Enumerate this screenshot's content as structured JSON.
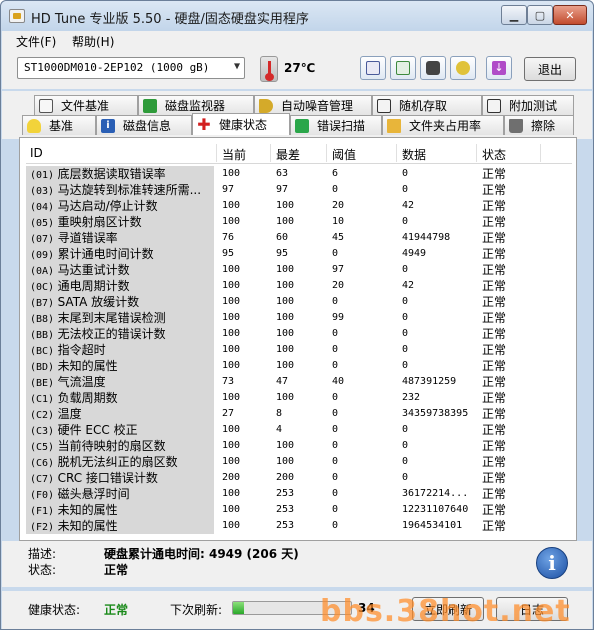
{
  "window": {
    "title": "HD Tune 专业版 5.50 - 硬盘/固态硬盘实用程序"
  },
  "menu": [
    {
      "label": "文件(F)"
    },
    {
      "label": "帮助(H)"
    }
  ],
  "toolbar": {
    "drive": "ST1000DM010-2EP102 (1000 gB)",
    "temperature": "27℃",
    "exit_label": "退出"
  },
  "tabs_row1": [
    {
      "label": "文件基准",
      "icon": "document-benchmark-icon"
    },
    {
      "label": "磁盘监视器",
      "icon": "disk-monitor-icon"
    },
    {
      "label": "自动噪音管理",
      "icon": "speaker-icon"
    },
    {
      "label": "随机存取",
      "icon": "random-access-icon"
    },
    {
      "label": "附加测试",
      "icon": "extra-tests-icon"
    }
  ],
  "tabs_row2": [
    {
      "label": "基准",
      "icon": "lightbulb-icon"
    },
    {
      "label": "磁盘信息",
      "icon": "info-icon"
    },
    {
      "label": "健康状态",
      "icon": "red-cross-icon",
      "active": true
    },
    {
      "label": "错误扫描",
      "icon": "error-scan-icon"
    },
    {
      "label": "文件夹占用率",
      "icon": "folder-icon"
    },
    {
      "label": "擦除",
      "icon": "trash-icon"
    }
  ],
  "table": {
    "headers": {
      "id": "ID",
      "current": "当前",
      "worst": "最差",
      "threshold": "阈值",
      "data": "数据",
      "status": "状态"
    },
    "rows": [
      {
        "code": "(01)",
        "name": "底层数据读取错误率",
        "current": "100",
        "worst": "63",
        "threshold": "6",
        "data": "0",
        "status": "正常"
      },
      {
        "code": "(03)",
        "name": "马达旋转到标准转速所需...",
        "current": "97",
        "worst": "97",
        "threshold": "0",
        "data": "0",
        "status": "正常"
      },
      {
        "code": "(04)",
        "name": "马达启动/停止计数",
        "current": "100",
        "worst": "100",
        "threshold": "20",
        "data": "42",
        "status": "正常"
      },
      {
        "code": "(05)",
        "name": "重映射扇区计数",
        "current": "100",
        "worst": "100",
        "threshold": "10",
        "data": "0",
        "status": "正常"
      },
      {
        "code": "(07)",
        "name": "寻道错误率",
        "current": "76",
        "worst": "60",
        "threshold": "45",
        "data": "41944798",
        "status": "正常"
      },
      {
        "code": "(09)",
        "name": "累计通电时间计数",
        "current": "95",
        "worst": "95",
        "threshold": "0",
        "data": "4949",
        "status": "正常"
      },
      {
        "code": "(0A)",
        "name": "马达重试计数",
        "current": "100",
        "worst": "100",
        "threshold": "97",
        "data": "0",
        "status": "正常"
      },
      {
        "code": "(0C)",
        "name": "通电周期计数",
        "current": "100",
        "worst": "100",
        "threshold": "20",
        "data": "42",
        "status": "正常"
      },
      {
        "code": "(B7)",
        "name": "SATA 放缓计数",
        "current": "100",
        "worst": "100",
        "threshold": "0",
        "data": "0",
        "status": "正常"
      },
      {
        "code": "(B8)",
        "name": "末尾到末尾错误检测",
        "current": "100",
        "worst": "100",
        "threshold": "99",
        "data": "0",
        "status": "正常"
      },
      {
        "code": "(BB)",
        "name": "无法校正的错误计数",
        "current": "100",
        "worst": "100",
        "threshold": "0",
        "data": "0",
        "status": "正常"
      },
      {
        "code": "(BC)",
        "name": "指令超时",
        "current": "100",
        "worst": "100",
        "threshold": "0",
        "data": "0",
        "status": "正常"
      },
      {
        "code": "(BD)",
        "name": "未知的属性",
        "current": "100",
        "worst": "100",
        "threshold": "0",
        "data": "0",
        "status": "正常"
      },
      {
        "code": "(BE)",
        "name": "气流温度",
        "current": "73",
        "worst": "47",
        "threshold": "40",
        "data": "487391259",
        "status": "正常"
      },
      {
        "code": "(C1)",
        "name": "负载周期数",
        "current": "100",
        "worst": "100",
        "threshold": "0",
        "data": "232",
        "status": "正常"
      },
      {
        "code": "(C2)",
        "name": "温度",
        "current": "27",
        "worst": "8",
        "threshold": "0",
        "data": "34359738395",
        "status": "正常"
      },
      {
        "code": "(C3)",
        "name": "硬件 ECC 校正",
        "current": "100",
        "worst": "4",
        "threshold": "0",
        "data": "0",
        "status": "正常"
      },
      {
        "code": "(C5)",
        "name": "当前待映射的扇区数",
        "current": "100",
        "worst": "100",
        "threshold": "0",
        "data": "0",
        "status": "正常"
      },
      {
        "code": "(C6)",
        "name": "脱机无法纠正的扇区数",
        "current": "100",
        "worst": "100",
        "threshold": "0",
        "data": "0",
        "status": "正常"
      },
      {
        "code": "(C7)",
        "name": "CRC 接口错误计数",
        "current": "200",
        "worst": "200",
        "threshold": "0",
        "data": "0",
        "status": "正常"
      },
      {
        "code": "(F0)",
        "name": "磁头悬浮时间",
        "current": "100",
        "worst": "253",
        "threshold": "0",
        "data": "36172214...",
        "status": "正常"
      },
      {
        "code": "(F1)",
        "name": "未知的属性",
        "current": "100",
        "worst": "253",
        "threshold": "0",
        "data": "12231107640",
        "status": "正常"
      },
      {
        "code": "(F2)",
        "name": "未知的属性",
        "current": "100",
        "worst": "253",
        "threshold": "0",
        "data": "1964534101",
        "status": "正常"
      }
    ]
  },
  "description": {
    "desc_label": "描述:",
    "desc_value": "硬盘累计通电时间: 4949 (206 天)",
    "state_label": "状态:",
    "state_value": "正常"
  },
  "statusbar": {
    "health_label": "健康状态:",
    "health_value": "正常",
    "refresh_label": "下次刷新:",
    "refresh_count": "34",
    "refresh_progress": 0.09,
    "refresh_button": "立即刷新",
    "log_button": "日志"
  },
  "watermark": "bbs.38hot.net",
  "colors": {
    "health_ok": "#1a8a1a",
    "window_frame": "#c8d9ec",
    "attribute_name_bg": "#d8d8d8"
  }
}
